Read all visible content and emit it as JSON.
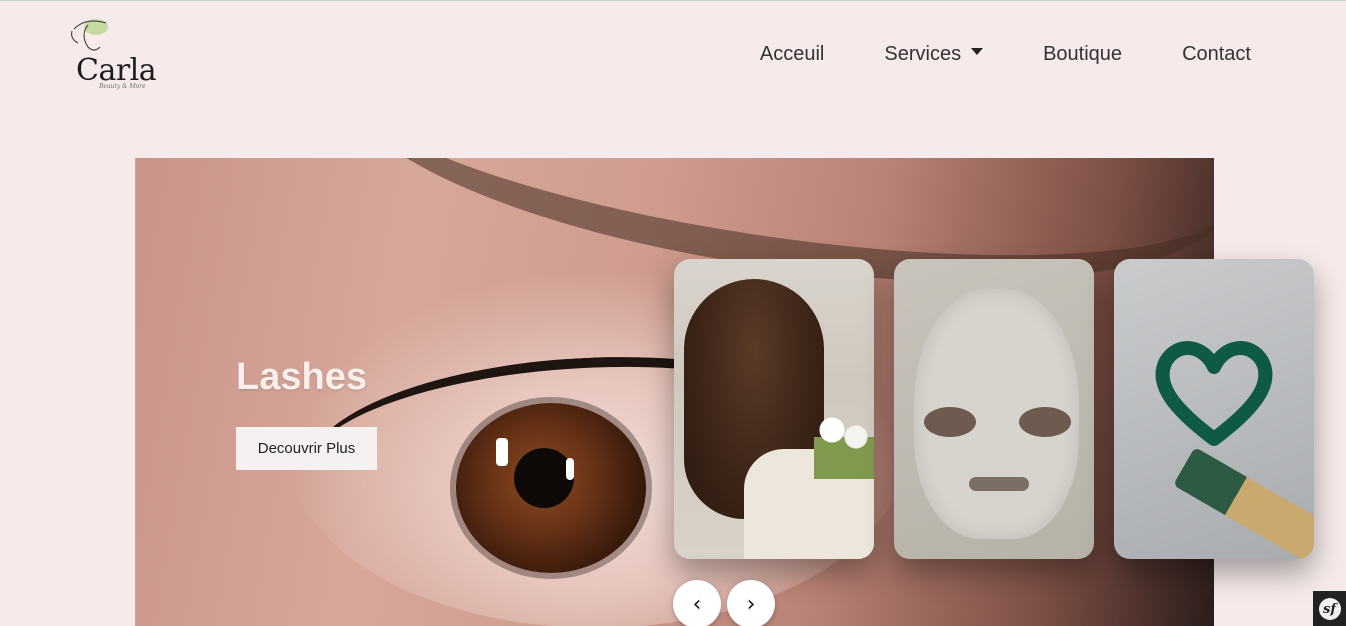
{
  "header": {
    "logo": {
      "name": "Carla",
      "tagline": "Beauty & More"
    },
    "nav": [
      {
        "label": "Acceuil"
      },
      {
        "label": "Services",
        "has_dropdown": true
      },
      {
        "label": "Boutique"
      },
      {
        "label": "Contact"
      }
    ]
  },
  "hero": {
    "title": "Lashes",
    "cta_label": "Decouvrir Plus"
  },
  "carousel": {
    "cards": [
      {
        "subject": "hair"
      },
      {
        "subject": "face-mask"
      },
      {
        "subject": "wax"
      }
    ],
    "prev_icon": "‹",
    "next_icon": "›"
  },
  "toolbar": {
    "icon": "symfony-icon",
    "glyph": "sf"
  },
  "colors": {
    "background": "#f6eaea",
    "hero_title": "#fbefec",
    "button_bg": "#f4f1f0"
  }
}
